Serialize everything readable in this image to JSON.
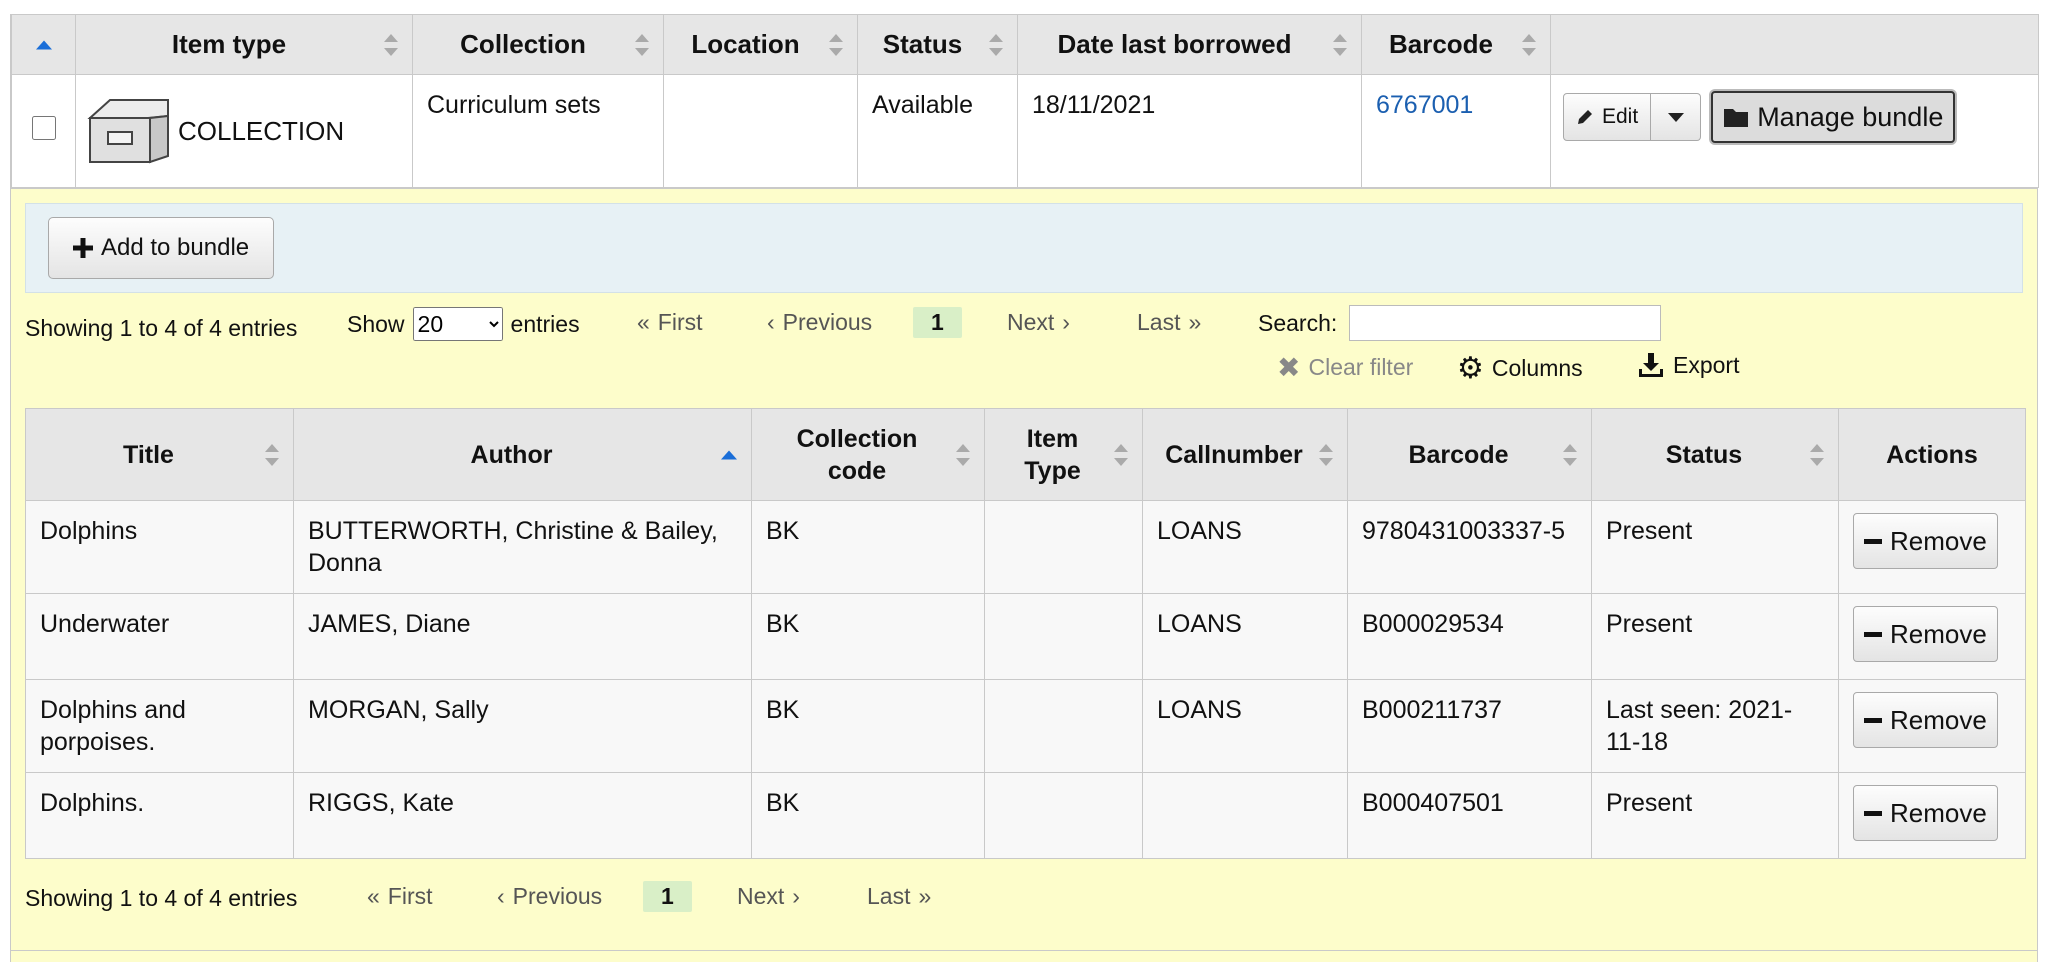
{
  "items_table": {
    "headers": [
      "Item type",
      "Collection",
      "Location",
      "Status",
      "Date last borrowed",
      "Barcode"
    ],
    "row": {
      "item_type": "COLLECTION",
      "collection": "Curriculum sets",
      "location": "",
      "status": "Available",
      "date_last_borrowed": "18/11/2021",
      "barcode": "6767001",
      "edit_label": "Edit",
      "manage_label": "Manage bundle"
    }
  },
  "bundle": {
    "add_label": "Add to bundle",
    "info": "Showing 1 to 4 of 4 entries",
    "show_label": "Show",
    "page_length": "20",
    "entries_label": "entries",
    "first": "First",
    "previous": "Previous",
    "page": "1",
    "next": "Next",
    "last": "Last",
    "search_label": "Search:",
    "search_value": "",
    "clear_filter": "Clear filter",
    "columns": "Columns",
    "export": "Export",
    "headers": {
      "title": "Title",
      "author": "Author",
      "collection_code_1": "Collection",
      "collection_code_2": "code",
      "item_type_1": "Item",
      "item_type_2": "Type",
      "callnumber": "Callnumber",
      "barcode": "Barcode",
      "status": "Status",
      "actions": "Actions"
    },
    "rows": [
      {
        "title": "Dolphins",
        "author": "BUTTERWORTH, Christine & Bailey, Donna",
        "ccode": "BK",
        "itype": "",
        "callnumber": "LOANS",
        "barcode": "9780431003337-5",
        "status": "Present",
        "action": "Remove"
      },
      {
        "title": "Underwater",
        "author": "JAMES, Diane",
        "ccode": "BK",
        "itype": "",
        "callnumber": "LOANS",
        "barcode": "B000029534",
        "status": "Present",
        "action": "Remove"
      },
      {
        "title": "Dolphins and porpoises.",
        "author": "MORGAN, Sally",
        "ccode": "BK",
        "itype": "",
        "callnumber": "LOANS",
        "barcode": "B000211737",
        "status": "Last seen: 2021-11-18",
        "action": "Remove"
      },
      {
        "title": "Dolphins.",
        "author": "RIGGS, Kate",
        "ccode": "BK",
        "itype": "",
        "callnumber": "",
        "barcode": "B000407501",
        "status": "Present",
        "action": "Remove"
      }
    ],
    "bottom_info": "Showing 1 to 4 of 4 entries"
  },
  "colors": {
    "link": "#1b5fb0",
    "panel_bg": "#fdfdcb",
    "toolbar_bg": "#e7f1f5",
    "current_page": "#d9efc7"
  },
  "icons": [
    "box-icon",
    "pencil-icon",
    "caret-down-icon",
    "folder-icon",
    "plus-icon",
    "times-icon",
    "gear-icon",
    "download-icon",
    "minus-icon"
  ]
}
